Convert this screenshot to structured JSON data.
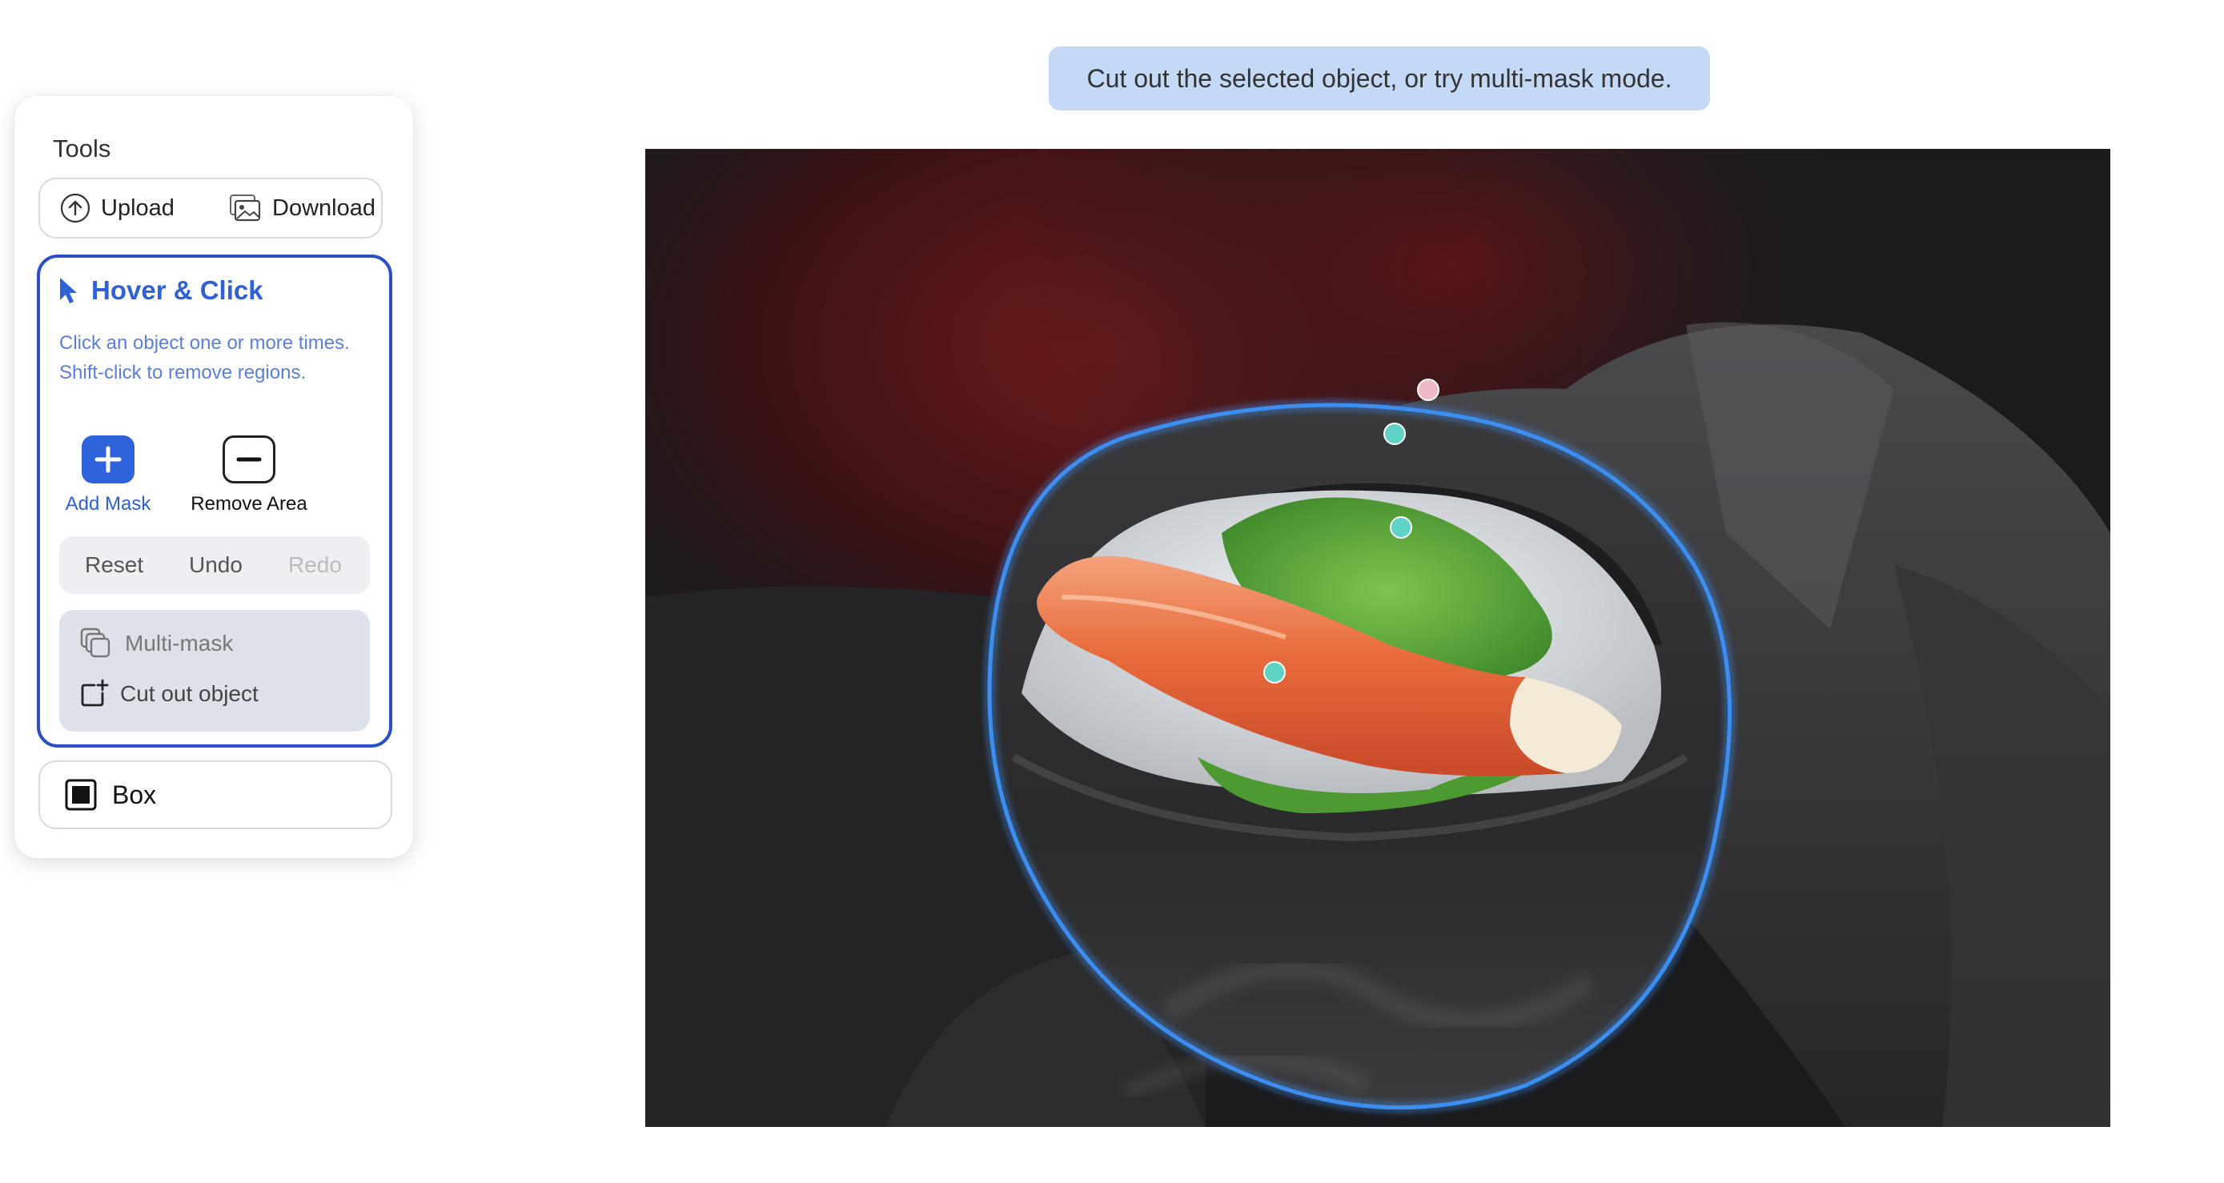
{
  "tools": {
    "title": "Tools",
    "upload_label": "Upload",
    "download_label": "Download"
  },
  "hover_click": {
    "title": "Hover & Click",
    "description": "Click an object one or more times. Shift-click to remove regions.",
    "add_mask_label": "Add Mask",
    "remove_area_label": "Remove Area",
    "reset_label": "Reset",
    "undo_label": "Undo",
    "redo_label": "Redo",
    "multi_mask_label": "Multi-mask",
    "cut_out_label": "Cut out object"
  },
  "box": {
    "label": "Box"
  },
  "hint": {
    "text": "Cut out the selected object, or try multi-mask mode."
  },
  "colors": {
    "accent": "#2e60d6",
    "active_border": "#2a4fc9",
    "hint_bg": "#c4d9f6",
    "positive_point": "#5fd3c4",
    "negative_point": "#f1b8c6",
    "mask_outline": "#3c8ef0"
  },
  "icons": {
    "upload": "upload-icon",
    "download": "download-icon",
    "cursor": "cursor-icon",
    "add": "plus-icon",
    "remove": "minus-icon",
    "multi_mask": "multi-mask-icon",
    "cut_out": "cut-out-icon",
    "box": "box-icon"
  }
}
